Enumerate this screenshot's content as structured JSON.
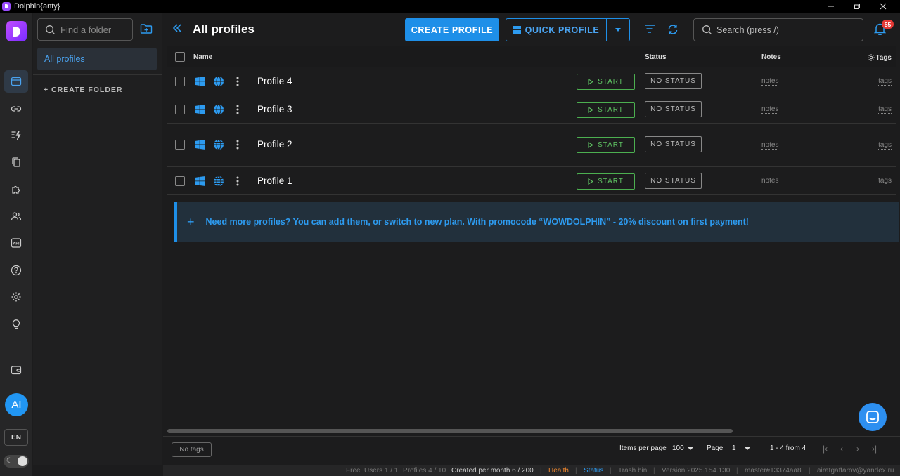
{
  "window": {
    "title": "Dolphin{anty}"
  },
  "sidebar": {
    "items": [
      {
        "name": "profiles",
        "icon": "browser-window-icon"
      },
      {
        "name": "proxies",
        "icon": "link-icon"
      },
      {
        "name": "automation",
        "icon": "lightning-list-icon"
      },
      {
        "name": "templates",
        "icon": "copy-icon"
      },
      {
        "name": "extensions",
        "icon": "puzzle-icon"
      },
      {
        "name": "users",
        "icon": "users-icon"
      },
      {
        "name": "api",
        "icon": "api-icon",
        "label": "API"
      },
      {
        "name": "help",
        "icon": "question-icon"
      },
      {
        "name": "settings",
        "icon": "gear-icon"
      },
      {
        "name": "tips",
        "icon": "lightbulb-icon"
      },
      {
        "name": "wallet",
        "icon": "wallet-icon"
      }
    ],
    "avatar_initials": "AI",
    "language": "EN",
    "theme_icon": "☾"
  },
  "folders": {
    "search_placeholder": "Find a folder",
    "items": [
      "All profiles"
    ],
    "create_label": "+ CREATE FOLDER"
  },
  "header": {
    "title": "All profiles",
    "create_profile": "CREATE PROFILE",
    "quick_profile": "QUICK PROFILE",
    "search_placeholder": "Search (press /)",
    "notifications_count": "55"
  },
  "table": {
    "columns": {
      "name": "Name",
      "status": "Status",
      "notes": "Notes",
      "tags": "Tags"
    },
    "rows": [
      {
        "name": "Profile 4",
        "start": "START",
        "status": "NO STATUS",
        "notes": "notes",
        "tags": "tags"
      },
      {
        "name": "Profile 3",
        "start": "START",
        "status": "NO STATUS",
        "notes": "notes",
        "tags": "tags"
      },
      {
        "name": "Profile 2",
        "start": "START",
        "status": "NO STATUS",
        "notes": "notes",
        "tags": "tags"
      },
      {
        "name": "Profile 1",
        "start": "START",
        "status": "NO STATUS",
        "notes": "notes",
        "tags": "tags"
      }
    ]
  },
  "promo": {
    "text": "Need more profiles? You can add them, or switch to new plan. With promocode “WOWDOLPHIN” - 20% discount on first payment!"
  },
  "pagination": {
    "no_tags": "No tags",
    "items_per_page_label": "Items per page",
    "items_per_page": "100",
    "page_label": "Page",
    "page": "1",
    "range": "1 - 4 from 4"
  },
  "statusbar": {
    "plan": "Free",
    "users": "Users 1 / 1",
    "profiles": "Profiles 4 / 10",
    "created": "Created per month 6 / 200",
    "health": "Health",
    "status": "Status",
    "trash": "Trash bin",
    "version": "Version 2025.154.130",
    "branch": "master#13374aa8",
    "email": "airatgaffarov@yandex.ru"
  },
  "colors": {
    "accent": "#1e8fe8",
    "start_green": "#4caf50",
    "badge_red": "#e53935",
    "health_orange": "#f0872d",
    "logo_purple": "#9b4dff"
  }
}
